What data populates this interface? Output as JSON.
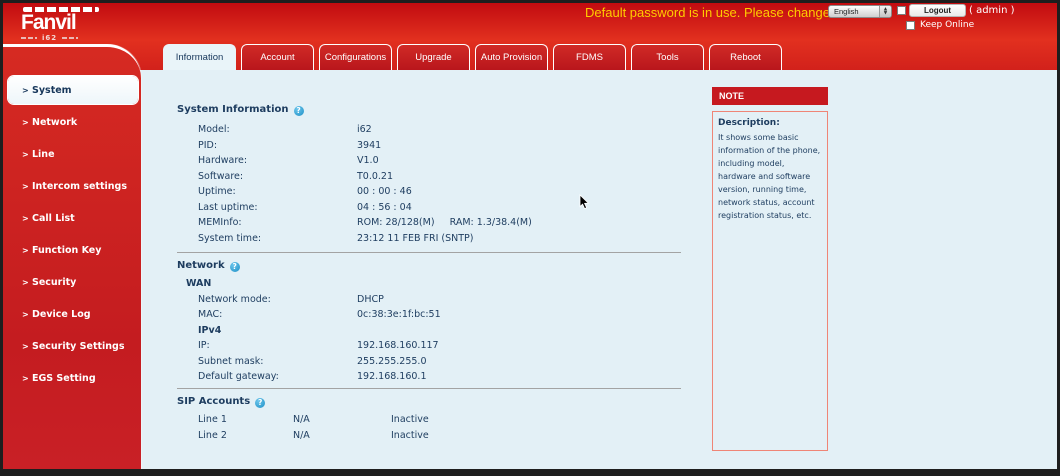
{
  "brand": {
    "name": "Fanvil",
    "model_badge": "i62"
  },
  "topbar": {
    "warning": "Default password is in use. Please change",
    "language_selected": "English",
    "logout_label": "Logout",
    "account_label": "( admin )",
    "keep_online_label": "Keep Online"
  },
  "tabs": [
    {
      "label": "Information",
      "active": true
    },
    {
      "label": "Account",
      "active": false
    },
    {
      "label": "Configurations",
      "active": false
    },
    {
      "label": "Upgrade",
      "active": false
    },
    {
      "label": "Auto Provision",
      "active": false
    },
    {
      "label": "FDMS",
      "active": false
    },
    {
      "label": "Tools",
      "active": false
    },
    {
      "label": "Reboot",
      "active": false
    }
  ],
  "sidebar": {
    "items": [
      {
        "label": "System",
        "active": true
      },
      {
        "label": "Network",
        "active": false
      },
      {
        "label": "Line",
        "active": false
      },
      {
        "label": "Intercom settings",
        "active": false
      },
      {
        "label": "Call List",
        "active": false
      },
      {
        "label": "Function Key",
        "active": false
      },
      {
        "label": "Security",
        "active": false
      },
      {
        "label": "Device Log",
        "active": false
      },
      {
        "label": "Security Settings",
        "active": false
      },
      {
        "label": "EGS Setting",
        "active": false
      }
    ],
    "chevron": ">"
  },
  "sections": {
    "system_info": {
      "title": "System Information",
      "rows": [
        {
          "label": "Model:",
          "value": "i62"
        },
        {
          "label": "PID:",
          "value": "3941"
        },
        {
          "label": "Hardware:",
          "value": "V1.0"
        },
        {
          "label": "Software:",
          "value": "T0.0.21"
        },
        {
          "label": "Uptime:",
          "value": "00 : 00 : 46"
        },
        {
          "label": "Last uptime:",
          "value": "04 : 56 : 04"
        },
        {
          "label": "MEMInfo:",
          "value": "ROM: 28/128(M)     RAM: 1.3/38.4(M)"
        },
        {
          "label": "System time:",
          "value": "23:12 11 FEB FRI (SNTP)"
        }
      ]
    },
    "network": {
      "title": "Network",
      "group_wan": "WAN",
      "group_ipv4": "IPv4",
      "wan_rows": [
        {
          "label": "Network mode:",
          "value": "DHCP"
        },
        {
          "label": "MAC:",
          "value": "0c:38:3e:1f:bc:51"
        }
      ],
      "ipv4_rows": [
        {
          "label": "IP:",
          "value": "192.168.160.117"
        },
        {
          "label": "Subnet mask:",
          "value": "255.255.255.0"
        },
        {
          "label": "Default gateway:",
          "value": "192.168.160.1"
        }
      ]
    },
    "sip_accounts": {
      "title": "SIP Accounts",
      "rows": [
        {
          "line": "Line 1",
          "number": "N/A",
          "status": "Inactive"
        },
        {
          "line": "Line 2",
          "number": "N/A",
          "status": "Inactive"
        }
      ]
    }
  },
  "note": {
    "title": "NOTE",
    "description_label": "Description:",
    "description_text": "It shows some basic information of the phone, including model, hardware and software version, running time, network status, account registration status, etc."
  },
  "colors": {
    "accent_red": "#c6191f",
    "header_red_top": "#c10b10",
    "header_red_bottom": "#e2301f",
    "warning_yellow": "#ffcc00",
    "content_bg": "#e3f0f6",
    "text_navy": "#1d3c5f",
    "note_border": "#ef8576",
    "help_icon_blue": "#1d8fc6"
  }
}
